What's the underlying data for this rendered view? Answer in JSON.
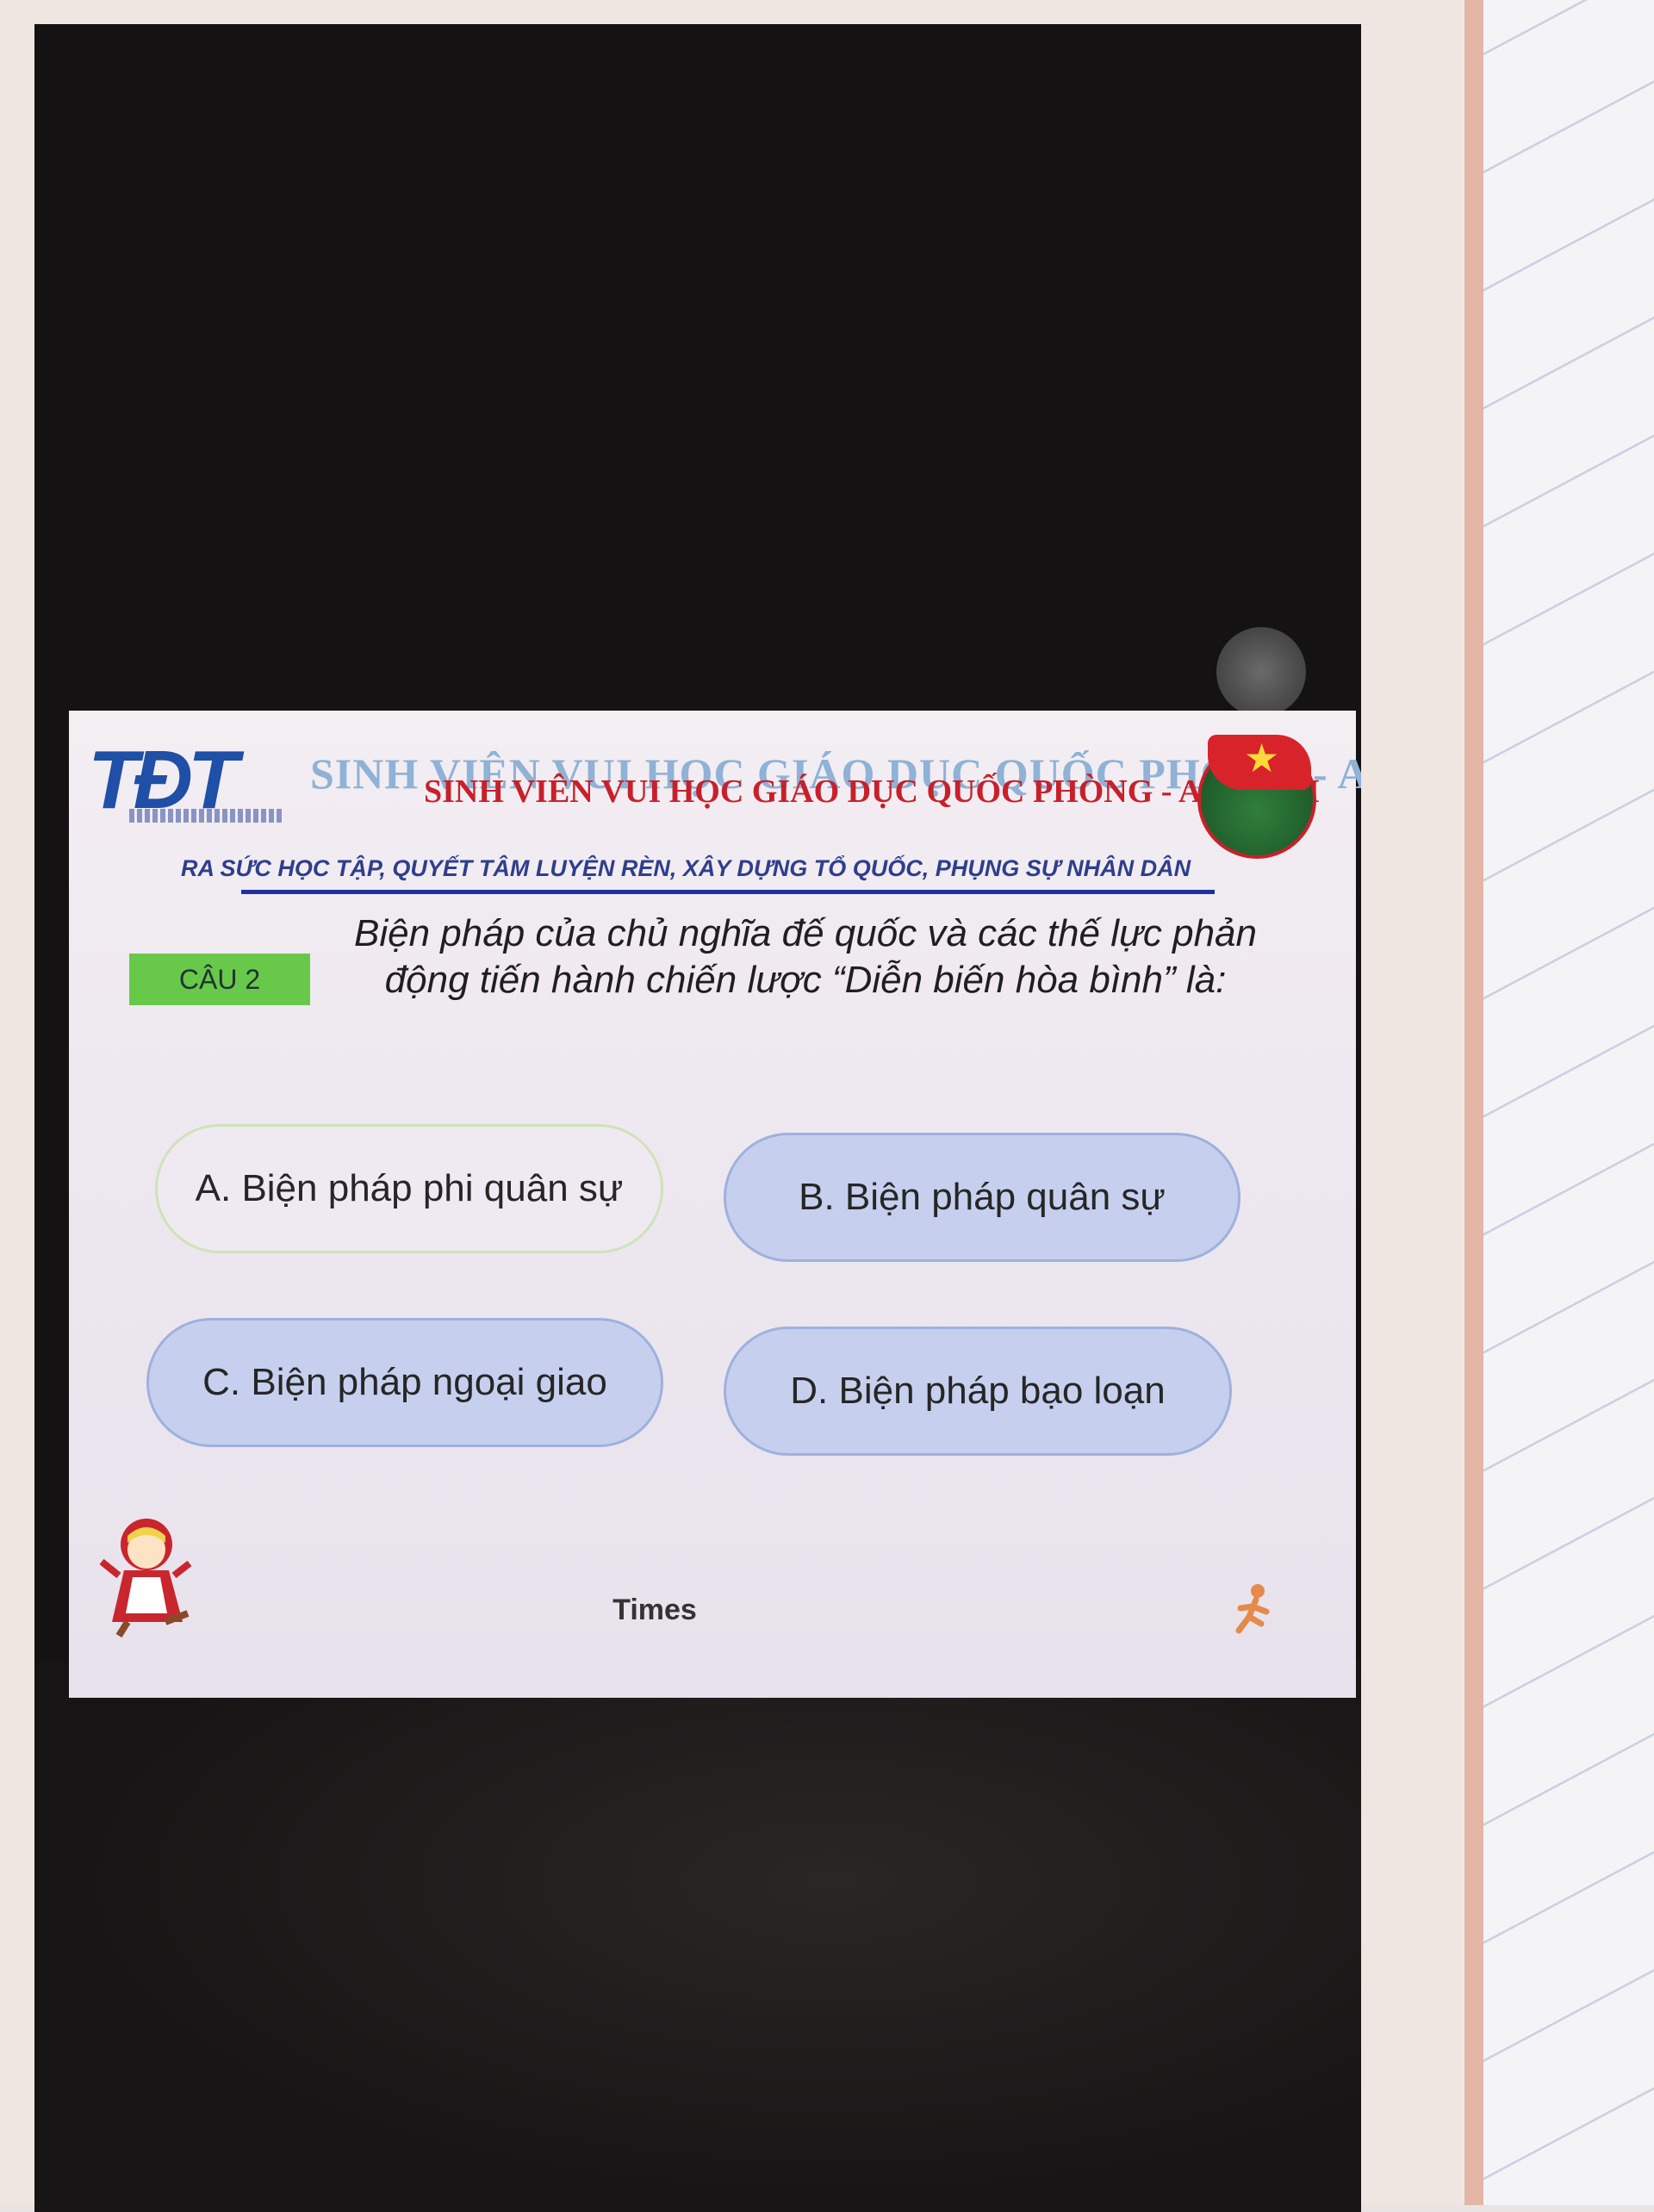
{
  "slide": {
    "logo_text": "TĐT",
    "banner_ghost": "SINH VIÊN VUI HỌC GIÁO DỤC QUỐC PHÒNG - AN NINH",
    "banner_title": "SINH VIÊN VUI HỌC GIÁO DỤC QUỐC PHÒNG - AN NINH",
    "motto": "RA SỨC HỌC TẬP, QUYẾT TÂM LUYỆN RÈN, XÂY DỰNG TỔ QUỐC, PHỤNG SỰ NHÂN DÂN",
    "question_number": "CÂU 2",
    "question_text": "Biện pháp của chủ nghĩa đế quốc và các thế lực phản động tiến hành chiến lược “Diễn biến hòa bình” là:",
    "answers": {
      "a": "A. Biện pháp phi quân sự",
      "b": "B. Biện pháp quân sự",
      "c": "C. Biện pháp ngoại giao",
      "d": "D. Biện pháp bạo loạn"
    },
    "timer_label": "Times"
  },
  "colors": {
    "banner_red": "#c8202a",
    "banner_blue_ghost": "#8fb2d6",
    "motto_blue": "#2f3e8c",
    "badge_green": "#68c84a",
    "answer_blue": "#c6d0ee"
  },
  "icons": {
    "emblem": "youth-union-emblem-icon",
    "mascot": "mascot-girl-icon",
    "runner": "running-figure-icon",
    "assistive": "assistive-touch-icon"
  }
}
